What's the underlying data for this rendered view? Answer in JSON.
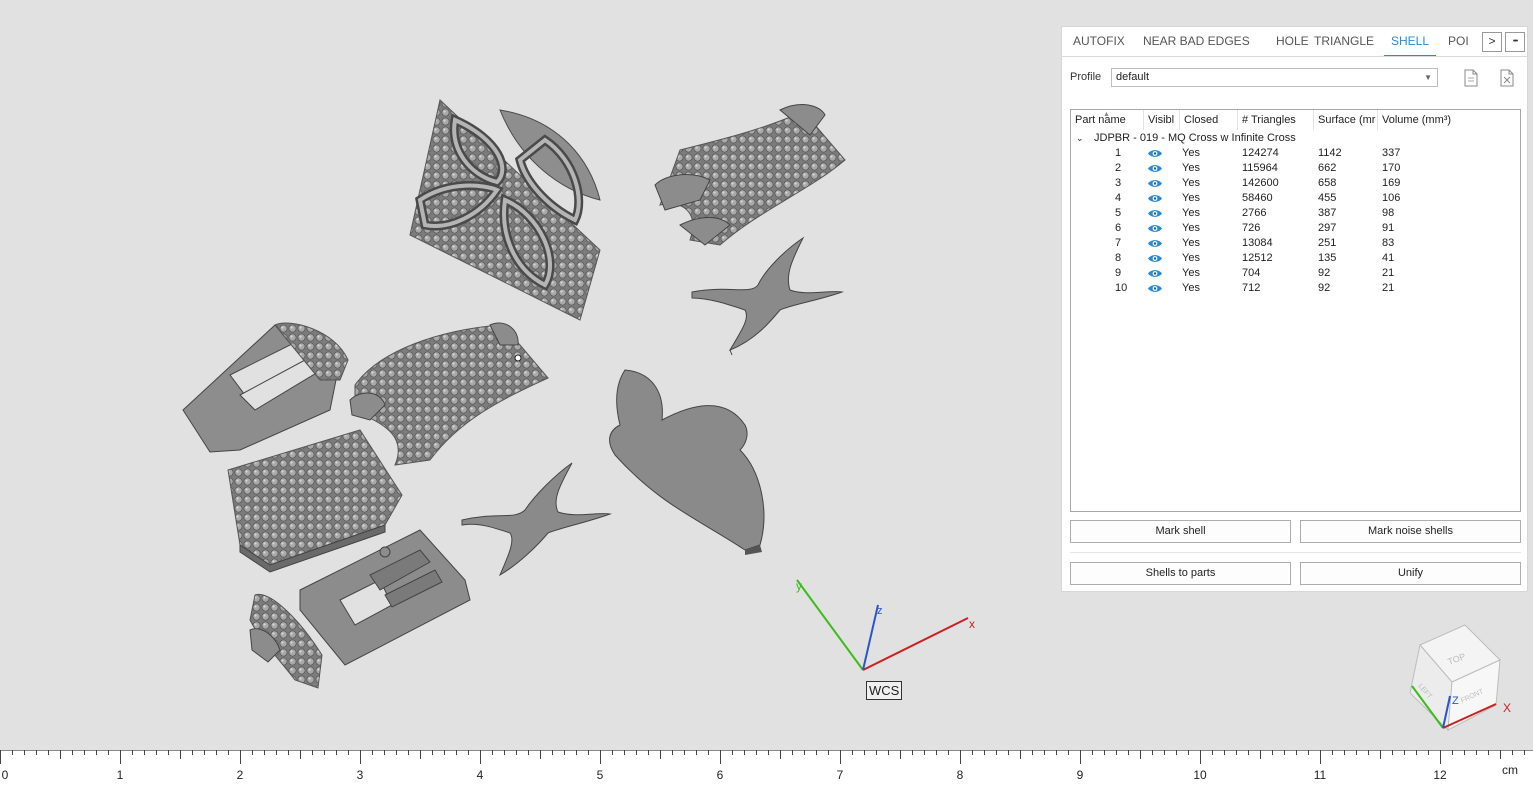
{
  "tabs": [
    {
      "label": "AUTOFIX",
      "active": false
    },
    {
      "label": "NEAR BAD EDGES",
      "active": false
    },
    {
      "label": "HOLE",
      "active": false
    },
    {
      "label": "TRIANGLE",
      "active": false
    },
    {
      "label": "SHELL",
      "active": true
    },
    {
      "label": "POI",
      "active": false
    }
  ],
  "tab_nav": {
    "next": ">",
    "more": "•••"
  },
  "profile": {
    "label": "Profile",
    "value": "default"
  },
  "table": {
    "headers": [
      "Part name",
      "Visibl",
      "Closed",
      "# Triangles",
      "Surface (mr",
      "Volume (mm³)"
    ],
    "group": {
      "expand_icon": "chevron-down-icon",
      "name": "JDPBR - 019 - MQ Cross w Infinite Cross"
    },
    "rows": [
      {
        "name": "1",
        "visible": true,
        "closed": "Yes",
        "triangles": "124274",
        "surface": "1142",
        "volume": "337"
      },
      {
        "name": "2",
        "visible": true,
        "closed": "Yes",
        "triangles": "115964",
        "surface": "662",
        "volume": "170"
      },
      {
        "name": "3",
        "visible": true,
        "closed": "Yes",
        "triangles": "142600",
        "surface": "658",
        "volume": "169"
      },
      {
        "name": "4",
        "visible": true,
        "closed": "Yes",
        "triangles": "58460",
        "surface": "455",
        "volume": "106"
      },
      {
        "name": "5",
        "visible": true,
        "closed": "Yes",
        "triangles": "2766",
        "surface": "387",
        "volume": "98"
      },
      {
        "name": "6",
        "visible": true,
        "closed": "Yes",
        "triangles": "726",
        "surface": "297",
        "volume": "91"
      },
      {
        "name": "7",
        "visible": true,
        "closed": "Yes",
        "triangles": "13084",
        "surface": "251",
        "volume": "83"
      },
      {
        "name": "8",
        "visible": true,
        "closed": "Yes",
        "triangles": "12512",
        "surface": "135",
        "volume": "41"
      },
      {
        "name": "9",
        "visible": true,
        "closed": "Yes",
        "triangles": "704",
        "surface": "92",
        "volume": "21"
      },
      {
        "name": "10",
        "visible": true,
        "closed": "Yes",
        "triangles": "712",
        "surface": "92",
        "volume": "21"
      }
    ]
  },
  "buttons": {
    "mark_shell": "Mark shell",
    "mark_noise": "Mark noise shells",
    "shells_to_parts": "Shells to parts",
    "unify": "Unify"
  },
  "viewport": {
    "wcs_label": "WCS",
    "axis_x": "x",
    "axis_y": "y",
    "axis_z": "z",
    "cube_top": "TOP",
    "cube_front": "FRONT",
    "cube_left": "LEFT",
    "cube_axis_x": "X",
    "cube_axis_z": "Z"
  },
  "ruler": {
    "unit": "cm",
    "labels": [
      "0",
      "1",
      "2",
      "3",
      "4",
      "5",
      "6",
      "7",
      "8",
      "9",
      "10",
      "11",
      "12"
    ]
  },
  "colors": {
    "accent": "#2a8ad4",
    "axis_x": "#cc1f1f",
    "axis_y": "#3dbb1c",
    "axis_z": "#2a55cc",
    "part_fill": "#8a8a8a",
    "background": "#e1e1e1"
  }
}
